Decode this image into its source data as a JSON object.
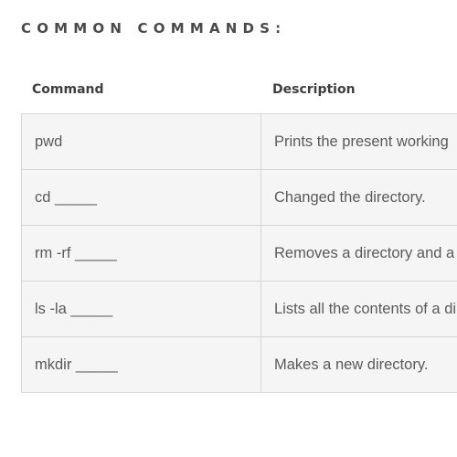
{
  "section": {
    "title": "COMMON COMMANDS:"
  },
  "table": {
    "headers": {
      "command": "Command",
      "description": "Description"
    },
    "rows": [
      {
        "command": "pwd",
        "description": "Prints the present working"
      },
      {
        "command": "cd _____",
        "description": "Changed the directory."
      },
      {
        "command": "rm -rf _____",
        "description": "Removes a directory and a"
      },
      {
        "command": "ls -la _____",
        "description": "Lists all the contents of a di"
      },
      {
        "command": "mkdir _____",
        "description": "Makes a new directory."
      }
    ]
  },
  "colors": {
    "title_text": "#4a4a4a",
    "header_text": "#3f3f3f",
    "cell_text": "#5a5a5a",
    "cell_background": "#f5f5f5",
    "border": "#d6d6d6"
  }
}
